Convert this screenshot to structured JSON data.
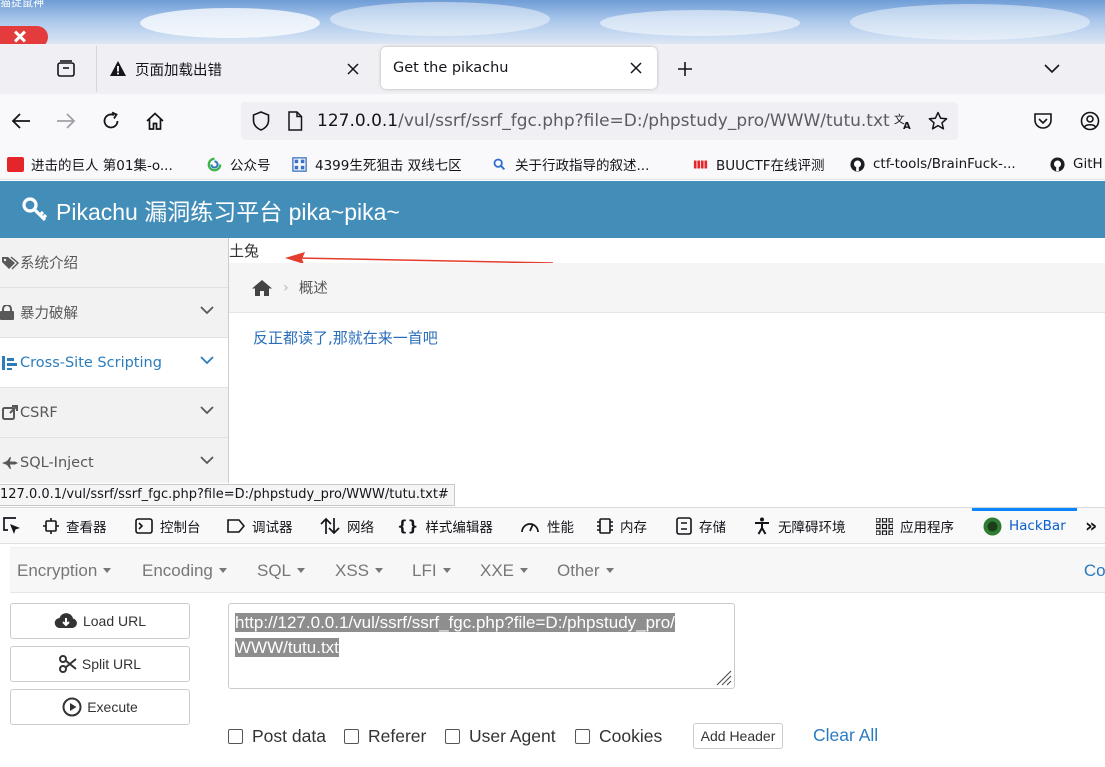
{
  "desktop": {
    "caption": "猫捉鼠神"
  },
  "tabs": [
    {
      "label": "页面加载出错",
      "icon": "warning-icon",
      "active": false
    },
    {
      "label": "Get the pikachu",
      "active": true
    }
  ],
  "nav": {
    "url_host": "127.0.0.1",
    "url_path": "/vul/ssrf/ssrf_fgc.php?file=D:/phpstudy_pro/WWW/tutu.txt"
  },
  "bookmarks": [
    {
      "label": "进击的巨人 第01集-o...",
      "icon": "video-site-icon",
      "color": "#e4262b"
    },
    {
      "label": "公众号",
      "icon": "wechat-icon",
      "color": "#3ab54a"
    },
    {
      "label": "4399生死狙击 双线七区",
      "icon": "game-grid-icon",
      "color": "#3b73c4"
    },
    {
      "label": "关于行政指导的叙述...",
      "icon": "search-icon",
      "color": "#2f6dd0"
    },
    {
      "label": "BUUCTF在线评测",
      "icon": "buu-icon",
      "color": "#e4262b"
    },
    {
      "label": "ctf-tools/BrainFuck-...",
      "icon": "github-icon",
      "color": "#1b1f23"
    },
    {
      "label": "GitH",
      "icon": "github-icon",
      "color": "#1b1f23"
    }
  ],
  "site": {
    "title": "Pikachu 漏洞练习平台 pika~pika~",
    "sidebar": [
      {
        "label": "系统介绍",
        "icon": "tags-icon"
      },
      {
        "label": "暴力破解",
        "icon": "lock-icon"
      },
      {
        "label": "Cross-Site Scripting",
        "icon": "sitemap-icon"
      },
      {
        "label": "CSRF",
        "icon": "share-icon"
      },
      {
        "label": "SQL-Inject",
        "icon": "fighter-jet-icon"
      }
    ],
    "content_text": "土兔",
    "breadcrumb": "概述",
    "content_link": "反正都读了,那就在来一首吧"
  },
  "status_url": "127.0.0.1/vul/ssrf/ssrf_fgc.php?file=D:/phpstudy_pro/WWW/tutu.txt#",
  "devtools": {
    "tabs": [
      "查看器",
      "控制台",
      "调试器",
      "网络",
      "样式编辑器",
      "性能",
      "内存",
      "存储",
      "无障碍环境",
      "应用程序",
      "HackBar"
    ],
    "overflow": "»"
  },
  "hackbar": {
    "menu": [
      "Encryption",
      "Encoding",
      "SQL",
      "XSS",
      "LFI",
      "XXE",
      "Other"
    ],
    "connect": "Con",
    "buttons": [
      "Load URL",
      "Split URL",
      "Execute"
    ],
    "url_lines": [
      "http://127.0.0.1/vul/ssrf/ssrf_fgc.php?file=D:/phpstudy_pro/",
      "WWW/tutu.txt"
    ],
    "checks": [
      "Post data",
      "Referer",
      "User Agent",
      "Cookies"
    ],
    "add_header": "Add Header",
    "clear_all": "Clear All"
  }
}
